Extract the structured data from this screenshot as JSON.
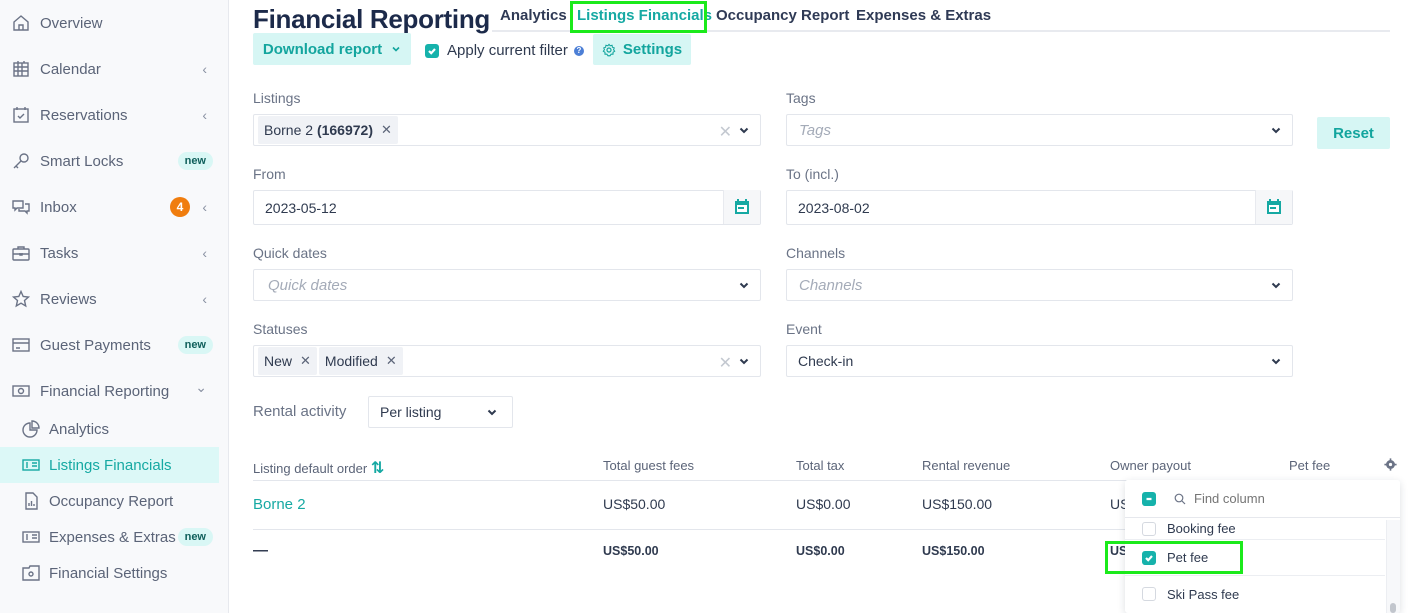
{
  "sidebar": {
    "items": [
      {
        "label": "Overview",
        "icon": "home-icon"
      },
      {
        "label": "Calendar",
        "icon": "calendar-icon",
        "chevron": "‹"
      },
      {
        "label": "Reservations",
        "icon": "reservations-icon",
        "chevron": "‹"
      },
      {
        "label": "Smart Locks",
        "icon": "key-icon",
        "badge": "new"
      },
      {
        "label": "Inbox",
        "icon": "chat-icon",
        "count": "4",
        "chevron": "‹"
      },
      {
        "label": "Tasks",
        "icon": "briefcase-icon",
        "chevron": "‹"
      },
      {
        "label": "Reviews",
        "icon": "star-icon",
        "chevron": "‹"
      },
      {
        "label": "Guest Payments",
        "icon": "card-icon",
        "badge": "new"
      },
      {
        "label": "Financial Reporting",
        "icon": "money-icon",
        "chevron": "⌄"
      }
    ],
    "subitems": [
      {
        "label": "Analytics",
        "icon": "pie-chart-icon"
      },
      {
        "label": "Listings Financials",
        "icon": "dollar-list-icon",
        "active": true
      },
      {
        "label": "Occupancy Report",
        "icon": "report-file-icon"
      },
      {
        "label": "Expenses & Extras",
        "icon": "dollar-list-icon",
        "badge": "new"
      },
      {
        "label": "Financial Settings",
        "icon": "folder-settings-icon"
      }
    ]
  },
  "header": {
    "title": "Financial Reporting",
    "tabs": [
      {
        "label": "Analytics"
      },
      {
        "label": "Listings Financials",
        "active": true
      },
      {
        "label": "Occupancy Report"
      },
      {
        "label": "Expenses & Extras"
      }
    ]
  },
  "toolbar": {
    "download_label": "Download report",
    "apply_filter_label": "Apply current filter",
    "apply_filter_checked": true,
    "help_icon": "?",
    "settings_label": "Settings",
    "reset_label": "Reset"
  },
  "filters": {
    "listings": {
      "label": "Listings",
      "chips": [
        {
          "name": "Borne 2",
          "id": "(166972)"
        }
      ]
    },
    "tags": {
      "label": "Tags",
      "placeholder": "Tags"
    },
    "from": {
      "label": "From",
      "value": "2023-05-12"
    },
    "to": {
      "label": "To (incl.)",
      "value": "2023-08-02"
    },
    "quick_dates": {
      "label": "Quick dates",
      "placeholder": "Quick dates"
    },
    "channels": {
      "label": "Channels",
      "placeholder": "Channels"
    },
    "statuses": {
      "label": "Statuses",
      "chips": [
        "New",
        "Modified"
      ]
    },
    "event": {
      "label": "Event",
      "value": "Check-in"
    },
    "rental_activity": {
      "label": "Rental activity",
      "value": "Per listing"
    }
  },
  "table": {
    "columns": [
      "Listing default order",
      "Total guest fees",
      "Total tax",
      "Rental revenue",
      "Owner payout",
      "Pet fee"
    ],
    "rows": [
      {
        "listing": "Borne 2",
        "guest_fees": "US$50.00",
        "tax": "US$0.00",
        "rental_revenue": "US$150.00",
        "owner_payout_partial": "US"
      }
    ],
    "totals": {
      "listing": "—",
      "guest_fees": "US$50.00",
      "tax": "US$0.00",
      "rental_revenue": "US$150.00",
      "owner_payout_partial": "US"
    }
  },
  "column_picker": {
    "search_placeholder": "Find column",
    "options": [
      {
        "label": "Booking fee",
        "checked": false
      },
      {
        "label": "Pet fee",
        "checked": true
      },
      {
        "label": "Ski Pass fee",
        "checked": false
      }
    ]
  },
  "colors": {
    "accent": "#16a9a3",
    "accent_soft": "#d6f6f4",
    "highlight": "#1bea1b",
    "badge_orange": "#f07d0e"
  }
}
